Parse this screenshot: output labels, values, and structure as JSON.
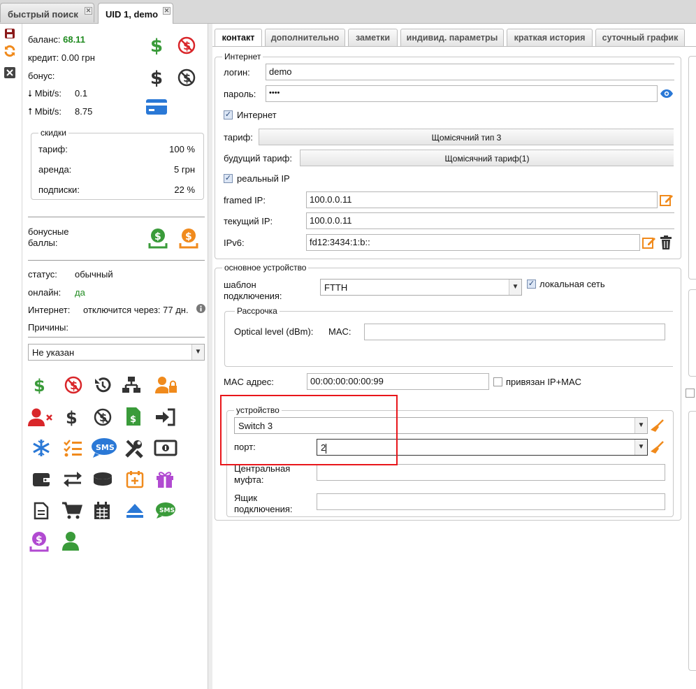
{
  "tabs": [
    {
      "label": "быстрый поиск",
      "active": false
    },
    {
      "label": "UID 1, demo",
      "active": true
    }
  ],
  "left": {
    "balance_label": "баланс:",
    "balance_value": "68.11",
    "credit": "кредит: 0.00 грн",
    "bonus_label": "бонус:",
    "down_label": "Mbit/s:",
    "down_value": "0.1",
    "up_label": "Mbit/s:",
    "up_value": "8.75",
    "discounts": {
      "legend": "скидки",
      "rows": [
        {
          "label": "тариф:",
          "value": "100",
          "unit": "%"
        },
        {
          "label": "аренда:",
          "value": "5",
          "unit": "грн"
        },
        {
          "label": "подписки:",
          "value": "22",
          "unit": "%"
        }
      ]
    },
    "bonus_points_line1": "бонусные",
    "bonus_points_line2": "баллы:",
    "status_label": "статус:",
    "status_value": "обычный",
    "online_label": "онлайн:",
    "online_value": "да",
    "internet_label": "Интернет:",
    "internet_value": "отключится через: 77 дн.",
    "reasons_label": "Причины:",
    "reason_select": "Не указан"
  },
  "main_tabs": [
    "контакт",
    "дополнительно",
    "заметки",
    "индивид. параметры",
    "краткая история",
    "суточный график"
  ],
  "internet": {
    "legend": "Интернет",
    "login_label": "логин:",
    "login_value": "demo",
    "password_label": "пароль:",
    "password_value": "••••",
    "internet_cb": "Интернет",
    "tariff_label": "тариф:",
    "tariff_value": "Щомісячний тип 3",
    "future_tariff_label": "будущий тариф:",
    "future_tariff_value": "Щомісячний тариф(1)",
    "real_ip_cb": "реальный IP",
    "framed_ip_label": "framed IP:",
    "framed_ip_value": "100.0.0.11",
    "current_ip_label": "текущий IP:",
    "current_ip_value": "100.0.0.11",
    "ipv6_label": "IPv6:",
    "ipv6_value": "fd12:3434:1:b::"
  },
  "device": {
    "legend": "основное устройство",
    "template_label_1": "шаблон",
    "template_label_2": "подключения:",
    "template_value": "FTTH",
    "local_net_cb": "локальная сеть",
    "installment_legend": "Рассрочка",
    "optical_label": "Optical level (dBm):",
    "mac_label": "MAC:",
    "mac_addr_label": "MAC адрес:",
    "mac_addr_value": "00:00:00:00:00:99",
    "bound_cb": "привязан IP+MAC",
    "sub": {
      "legend": "устройство",
      "switch_value": "Switch 3",
      "port_label": "порт:",
      "port_value": "2",
      "mufta_1": "Центральная",
      "mufta_2": "муфта:",
      "box_1": "Ящик",
      "box_2": "подключения:"
    }
  },
  "colors": {
    "green": "#3a9b3a",
    "red": "#d9262a",
    "orange": "#f08a1c",
    "purple": "#b14ad1",
    "blue": "#2a78d6",
    "dark": "#333333"
  }
}
